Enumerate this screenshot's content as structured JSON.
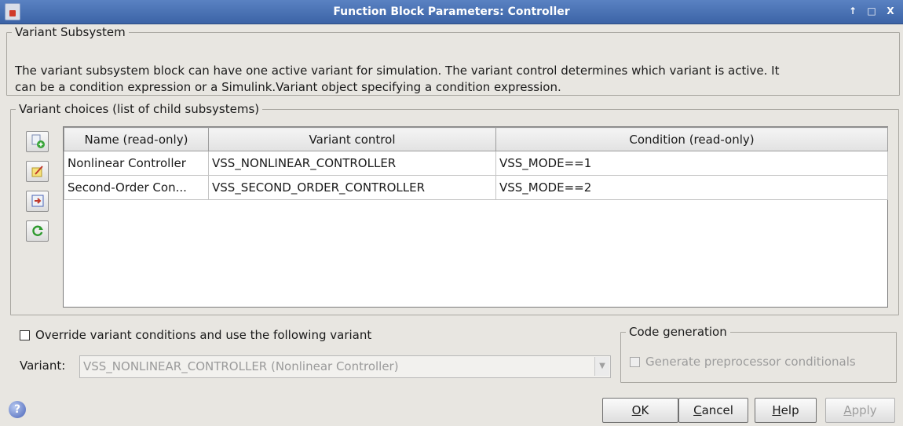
{
  "window": {
    "title": "Function Block Parameters: Controller",
    "buttons": [
      "↑",
      "□",
      "X"
    ]
  },
  "variant_subsystem": {
    "legend": "Variant Subsystem",
    "description_line1": "The variant subsystem block can have one active variant for simulation. The variant control determines which variant is active. It",
    "description_line2": "can be a condition expression or a Simulink.Variant object specifying a condition expression."
  },
  "choices": {
    "legend": "Variant choices (list of child subsystems)",
    "side_buttons": [
      "add-choice-icon",
      "edit-choice-icon",
      "open-choice-icon",
      "refresh-icon"
    ],
    "columns": [
      "Name (read-only)",
      "Variant control",
      "Condition (read-only)"
    ],
    "rows": [
      {
        "name": "Nonlinear Controller",
        "control": "VSS_NONLINEAR_CONTROLLER",
        "condition": "VSS_MODE==1"
      },
      {
        "name": "Second-Order Con...",
        "control": "VSS_SECOND_ORDER_CONTROLLER",
        "condition": "VSS_MODE==2"
      }
    ]
  },
  "override": {
    "label": "Override variant conditions and use the following variant",
    "checked": false
  },
  "variant": {
    "label": "Variant:",
    "selected": "VSS_NONLINEAR_CONTROLLER (Nonlinear Controller)"
  },
  "code_generation": {
    "legend": "Code generation",
    "checkbox_label": "Generate preprocessor conditionals",
    "checked": false
  },
  "footer": {
    "ok_mnemonic": "O",
    "ok_rest": "K",
    "cancel_mnemonic": "C",
    "cancel_rest": "ancel",
    "help_mnemonic": "H",
    "help_rest": "elp",
    "apply_mnemonic": "A",
    "apply_rest": "pply"
  }
}
